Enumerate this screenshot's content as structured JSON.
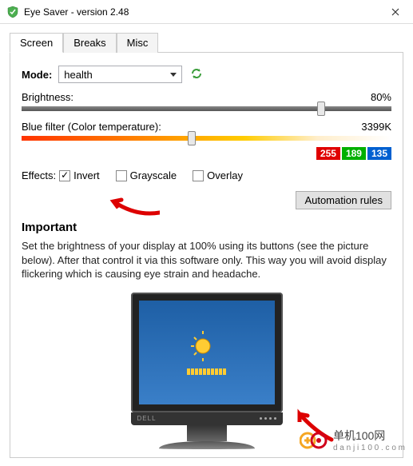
{
  "window": {
    "title": "Eye Saver - version 2.48"
  },
  "tabs": {
    "screen": "Screen",
    "breaks": "Breaks",
    "misc": "Misc"
  },
  "mode": {
    "label": "Mode:",
    "value": "health"
  },
  "brightness": {
    "label": "Brightness:",
    "value": "80%",
    "position": 80
  },
  "bluefilter": {
    "label": "Blue filter (Color temperature):",
    "value": "3399K",
    "position": 45
  },
  "rgb": {
    "r": "255",
    "g": "189",
    "b": "135"
  },
  "effects": {
    "label": "Effects:",
    "invert": {
      "label": "Invert",
      "checked": true
    },
    "grayscale": {
      "label": "Grayscale",
      "checked": false
    },
    "overlay": {
      "label": "Overlay",
      "checked": false
    }
  },
  "automation": {
    "button": "Automation rules"
  },
  "important": {
    "heading": "Important",
    "text": "Set the brightness of your display at 100% using its buttons (see the picture below). After that control it via this software only. This way you will avoid display flickering which is causing eye strain and headache."
  },
  "monitor": {
    "brand": "DELL"
  },
  "watermark": {
    "cn": "单机100网",
    "url": "d a n j i 1 0 0 . c o m"
  }
}
